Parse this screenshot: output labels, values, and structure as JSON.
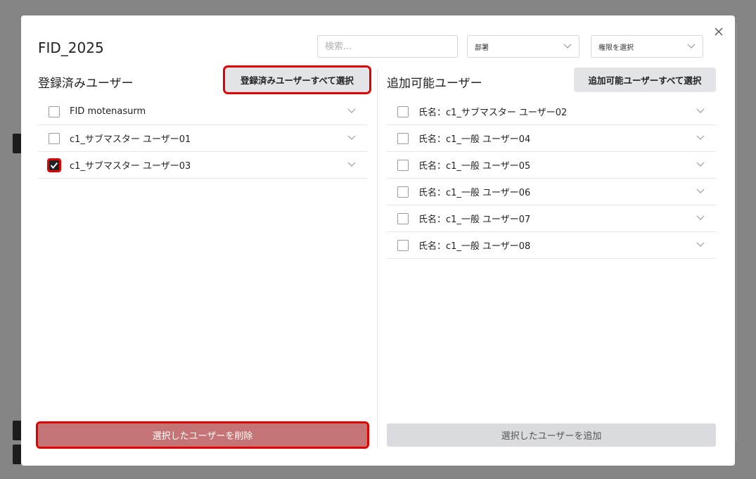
{
  "modal": {
    "title": "FID_2025",
    "search_placeholder": "検索...",
    "department_select": "部署",
    "permission_select": "権限を選択"
  },
  "left_panel": {
    "heading": "登録済みユーザー",
    "select_all_label": "登録済みユーザーすべて選択",
    "items": [
      {
        "label": "FID motenasurm",
        "checked": false
      },
      {
        "label": "c1_サブマスター ユーザー01",
        "checked": false
      },
      {
        "label": "c1_サブマスター ユーザー03",
        "checked": true
      }
    ],
    "action_label": "選択したユーザーを削除"
  },
  "right_panel": {
    "heading": "追加可能ユーザー",
    "select_all_label": "追加可能ユーザーすべて選択",
    "items": [
      {
        "label": "氏名：c1_サブマスター ユーザー02",
        "checked": false
      },
      {
        "label": "氏名：c1_一般 ユーザー04",
        "checked": false
      },
      {
        "label": "氏名：c1_一般 ユーザー05",
        "checked": false
      },
      {
        "label": "氏名：c1_一般 ユーザー06",
        "checked": false
      },
      {
        "label": "氏名：c1_一般 ユーザー07",
        "checked": false
      },
      {
        "label": "氏名：c1_一般 ユーザー08",
        "checked": false
      }
    ],
    "action_label": "選択したユーザーを追加"
  },
  "icons": {
    "close": "close-icon",
    "chevron": "chevron-down-icon",
    "check": "check-icon"
  },
  "colors": {
    "delete_button": "#c47474",
    "highlight_outline": "#e00000",
    "add_button": "#d9dbdf"
  }
}
